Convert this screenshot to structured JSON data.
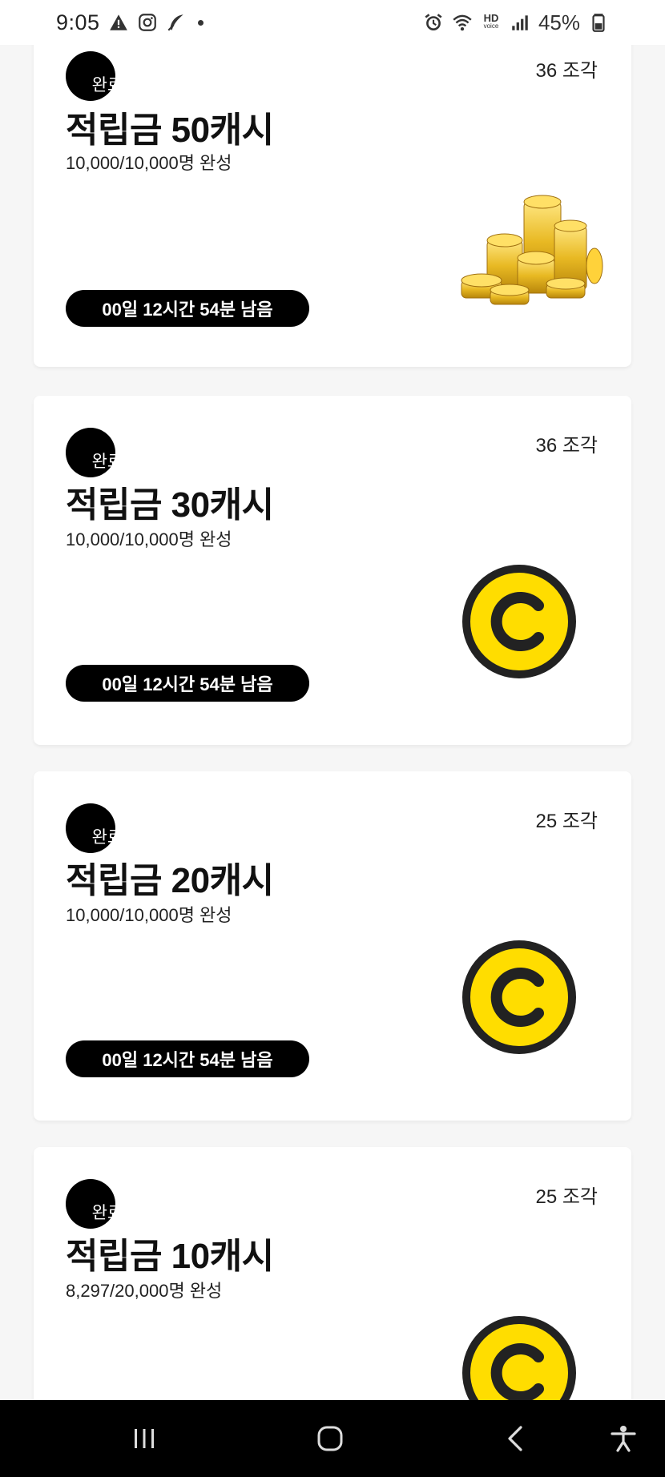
{
  "status_bar": {
    "time": "9:05",
    "battery": "45%",
    "icons_left": [
      "warning-icon",
      "instagram-icon",
      "feather-icon",
      "dot-icon"
    ],
    "icons_right": [
      "alarm-icon",
      "wifi-icon",
      "hd-voice-icon",
      "signal-icon",
      "battery-icon"
    ],
    "hd_top": "HD",
    "hd_bottom": "voice"
  },
  "cards": [
    {
      "done_label": "완료",
      "pieces": "36 조각",
      "title": "적립금 50캐시",
      "progress": "10,000/10,000명 완성",
      "time_left": "00일 12시간 54분 남음",
      "image": "coin-stack-icon"
    },
    {
      "done_label": "완료",
      "pieces": "36 조각",
      "title": "적립금 30캐시",
      "progress": "10,000/10,000명 완성",
      "time_left": "00일 12시간 54분 남음",
      "image": "cash-coin-icon"
    },
    {
      "done_label": "완료",
      "pieces": "25 조각",
      "title": "적립금 20캐시",
      "progress": "10,000/10,000명 완성",
      "time_left": "00일 12시간 54분 남음",
      "image": "cash-coin-icon"
    },
    {
      "done_label": "완료",
      "pieces": "25 조각",
      "title": "적립금 10캐시",
      "progress": "8,297/20,000명 완성",
      "image": "cash-coin-icon"
    }
  ],
  "nav_bar": {
    "buttons": [
      "recent-apps-icon",
      "home-icon",
      "back-icon",
      "accessibility-icon"
    ]
  },
  "colors": {
    "coin_yellow": "#FFDD00",
    "coin_outline": "#222222",
    "gold": "#E8B923",
    "background": "#F6F6F6"
  }
}
